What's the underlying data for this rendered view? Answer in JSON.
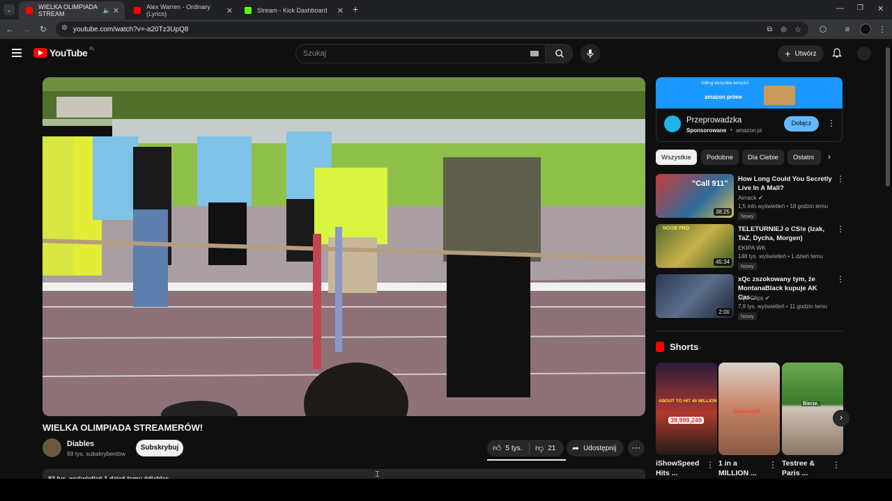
{
  "browser": {
    "tabs": [
      {
        "label": "WIELKA OLIMPIADA STREAM",
        "color": "#ff0000"
      },
      {
        "label": "Alex Warren - Ordinary (Lyrics)",
        "color": "#ff0000"
      },
      {
        "label": "Stream - Kick Dashboard",
        "color": "#53fc18"
      }
    ],
    "new_tab": "+",
    "url": "youtube.com/watch?v=-a20Tz3UpQ8"
  },
  "header": {
    "logo": "YouTube",
    "region": "PL",
    "search_placeholder": "Szukaj",
    "create_label": "Utwórz"
  },
  "video": {
    "title": "WIELKA OLIMPIADA STREAMERÓW!",
    "channel": "Diables",
    "subscribers": "69 tys. subskrybentów",
    "subscribe_label": "Subskrybuj",
    "likes": "5 tys.",
    "dislikes": "21",
    "share_label": "Udostępnij",
    "description_preview": "82 tys. wyświetleń  1 dzień temu  #diables"
  },
  "ad": {
    "banner_text": "Odkryj wszystkie korzyści",
    "banner_brand": "amazon prime",
    "title": "Przeprowadzka",
    "sponsored": "Sponsorowane",
    "domain": "amazon.pl",
    "join_label": "Dołącz"
  },
  "chips": [
    "Wszystkie",
    "Podobne",
    "Dla Ciebie",
    "Ostatni"
  ],
  "related": [
    {
      "title": "How Long Could You Secretly Live In A Mall?",
      "channel": "Airrack",
      "meta": "1,5 mln wyświetleń • 18 godzin temu",
      "badge": "Nowy",
      "duration": "38:25",
      "thumb_text": "\"Call 911\""
    },
    {
      "title": "TELETURNIEJ o CS!e (Izak, TaZ, Dycha, Morgen)",
      "channel": "EKIPA WK",
      "meta": "148 tys. wyświetleń • 1 dzień temu",
      "badge": "Nowy",
      "duration": "45:34",
      "thumb_text": "NOOB PRO"
    },
    {
      "title": "xQc zszokowany tym, że MontanaBlack kupuje AK Cas...",
      "channel": "xQc Clips",
      "meta": "7,9 tys. wyświetleń • 11 godzin temu",
      "badge": "Nowy",
      "duration": "2:00",
      "thumb_text": ""
    }
  ],
  "shorts": {
    "heading": "Shorts",
    "items": [
      {
        "title": "iShowSpeed Hits ...",
        "thumb_text": "ABOUT TO HIT 40 MILLION",
        "count": "39,999,249"
      },
      {
        "title": "1 in a MILLION ...",
        "thumb_text": "Gooooolll"
      },
      {
        "title": "Testree & Paris ...",
        "thumb_text": "Bierze."
      }
    ]
  },
  "colors": {
    "accent": "#ff0000",
    "chip_active": "#f1f1f1",
    "join_button": "#65b8ff",
    "prime": "#1a98ff"
  }
}
